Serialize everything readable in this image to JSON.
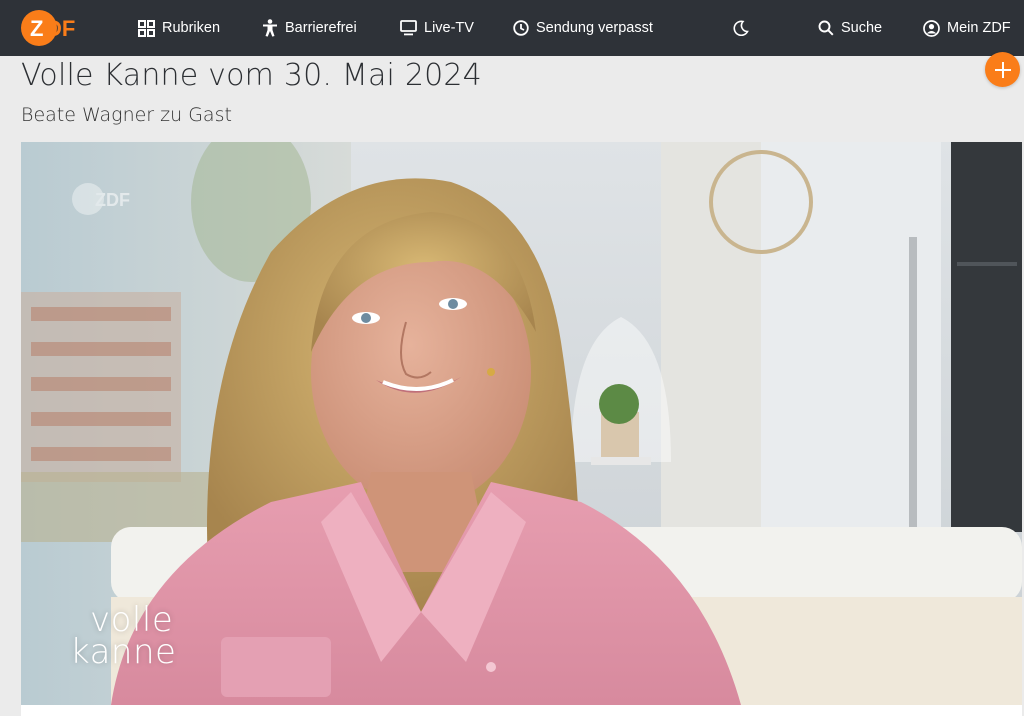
{
  "nav": {
    "logo_text": "ZDF",
    "rubriken": "Rubriken",
    "barrierefrei": "Barrierefrei",
    "livetv": "Live-TV",
    "verpasst": "Sendung verpasst",
    "suche": "Suche",
    "mein": "Mein ZDF"
  },
  "page": {
    "title": "Volle Kanne vom 30. Mai 2024",
    "subtitle": "Beate Wagner zu Gast"
  },
  "video": {
    "watermark": "ZDF",
    "show_logo_line1": "volle",
    "show_logo_line2": "kanne"
  },
  "icons": [
    "zdf-logo",
    "grid-icon",
    "accessibility-icon",
    "tv-icon",
    "clock-icon",
    "moon-icon",
    "search-icon",
    "user-icon",
    "plus-icon"
  ],
  "colors": {
    "brand_orange": "#fa7d19",
    "nav_background": "#2e3238",
    "page_background": "#ebebeb"
  }
}
